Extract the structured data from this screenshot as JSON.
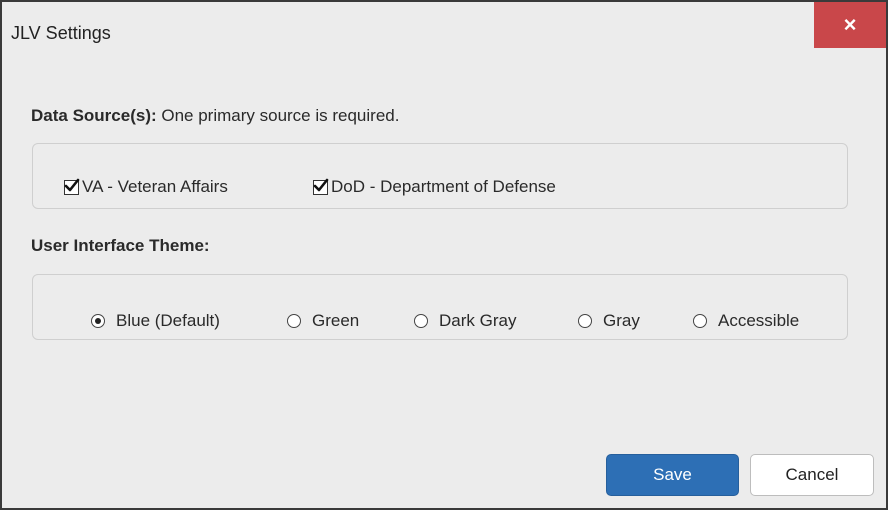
{
  "dialog": {
    "title": "JLV Settings",
    "close_glyph": "×"
  },
  "data_sources": {
    "label_bold": "Data Source(s):",
    "label_rest": " One primary source is required.",
    "options": [
      {
        "label": "VA - Veteran Affairs",
        "checked": true
      },
      {
        "label": "DoD - Department of Defense",
        "checked": true
      }
    ]
  },
  "theme": {
    "label": "User Interface Theme:",
    "options": [
      {
        "label": "Blue (Default)",
        "selected": true
      },
      {
        "label": "Green",
        "selected": false
      },
      {
        "label": "Dark Gray",
        "selected": false
      },
      {
        "label": "Gray",
        "selected": false
      },
      {
        "label": "Accessible",
        "selected": false
      }
    ]
  },
  "buttons": {
    "save": "Save",
    "cancel": "Cancel"
  },
  "colors": {
    "dialog_bg": "#ececec",
    "close_bg": "#c9474a",
    "save_bg": "#2d6fb5",
    "cancel_bg": "#ffffff"
  },
  "icons": {
    "close": "close-icon",
    "check": "checkmark-icon",
    "radio": "radio-dot-icon"
  }
}
